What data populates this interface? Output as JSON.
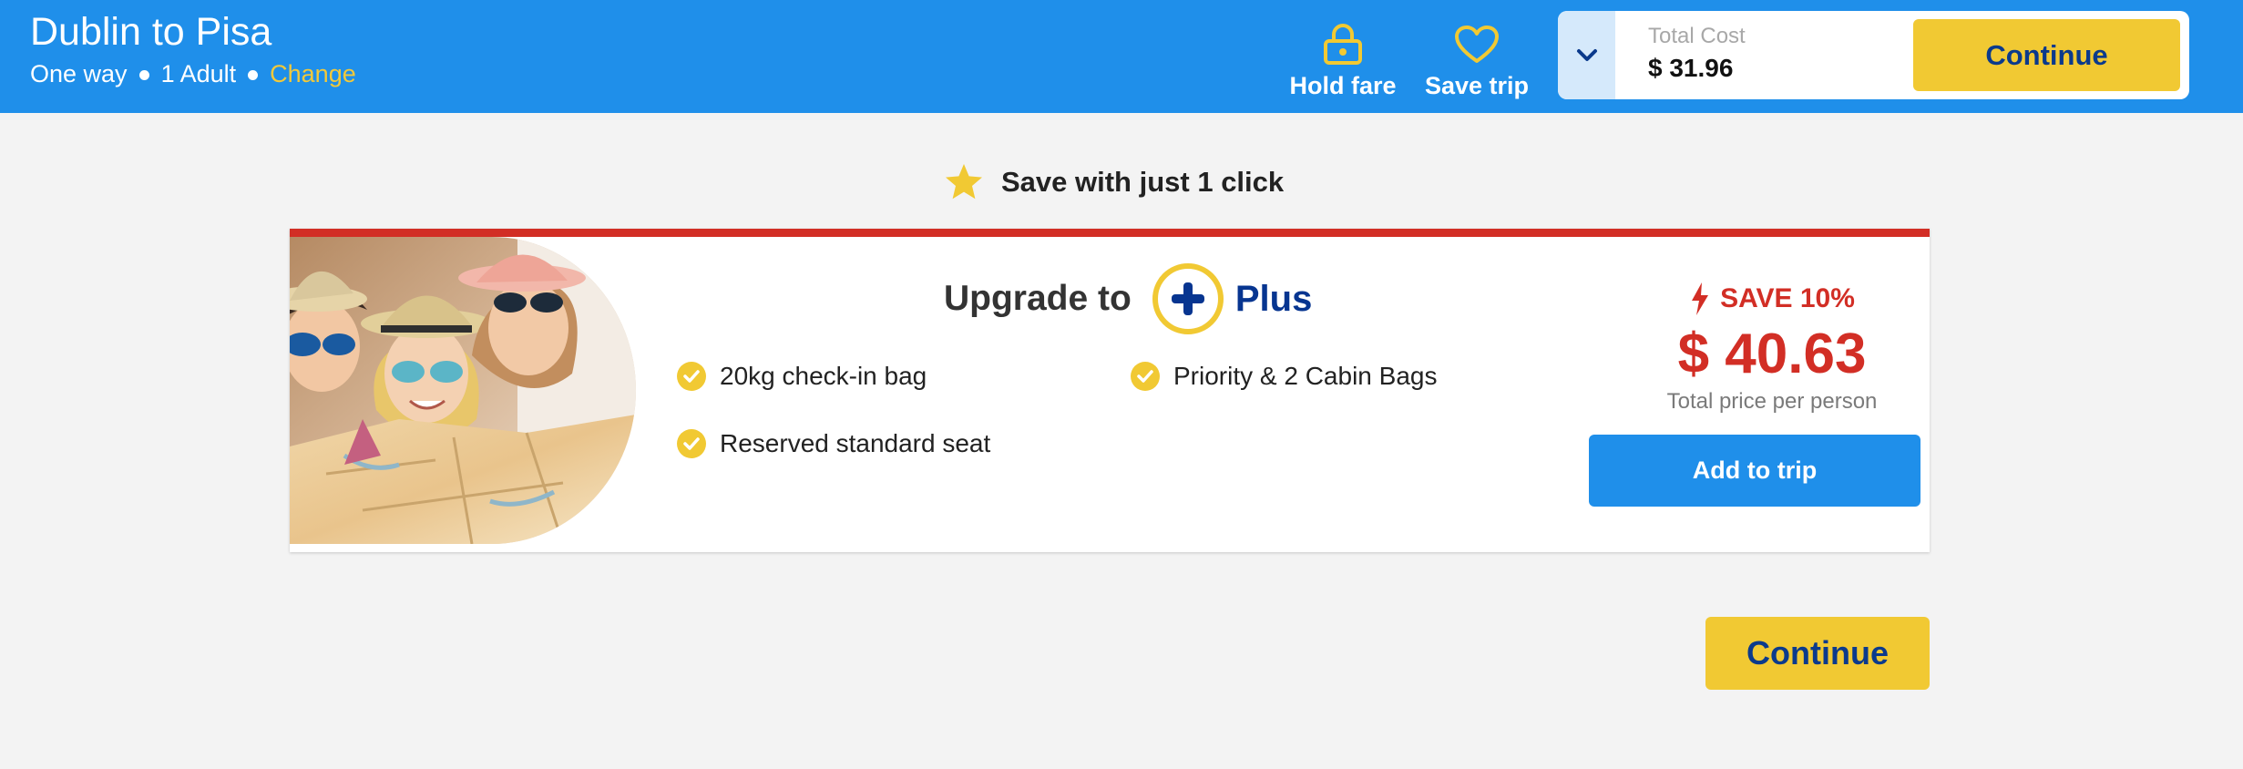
{
  "header": {
    "route_title": "Dublin to Pisa",
    "trip_type": "One way",
    "passengers": "1 Adult",
    "change_link": "Change",
    "hold_fare_label": "Hold fare",
    "save_trip_label": "Save trip",
    "total_cost_label": "Total Cost",
    "total_cost_value": "$ 31.96",
    "continue_label": "Continue"
  },
  "promo": {
    "text": "Save with just 1 click"
  },
  "upsell": {
    "title_prefix": "Upgrade to",
    "plan_name": "Plus",
    "features": [
      "20kg check-in bag",
      "Priority & 2 Cabin Bags",
      "Reserved standard seat"
    ],
    "save_badge": "SAVE 10%",
    "price": "$ 40.63",
    "price_caption": "Total price per person",
    "add_button": "Add to trip"
  },
  "footer": {
    "continue_label": "Continue"
  },
  "icons": {
    "hold_fare": "padlock-icon",
    "save_trip": "heart-icon",
    "toggle": "chevron-down-icon",
    "promo": "star-icon",
    "plan": "plus-circle-icon",
    "feature": "check-circle-icon",
    "save": "lightning-icon"
  },
  "colors": {
    "brand_blue": "#1f8fea",
    "accent_yellow": "#f1c933",
    "navy": "#0b3a8c",
    "sale_red": "#d22e25",
    "page_bg": "#f3f3f3"
  }
}
